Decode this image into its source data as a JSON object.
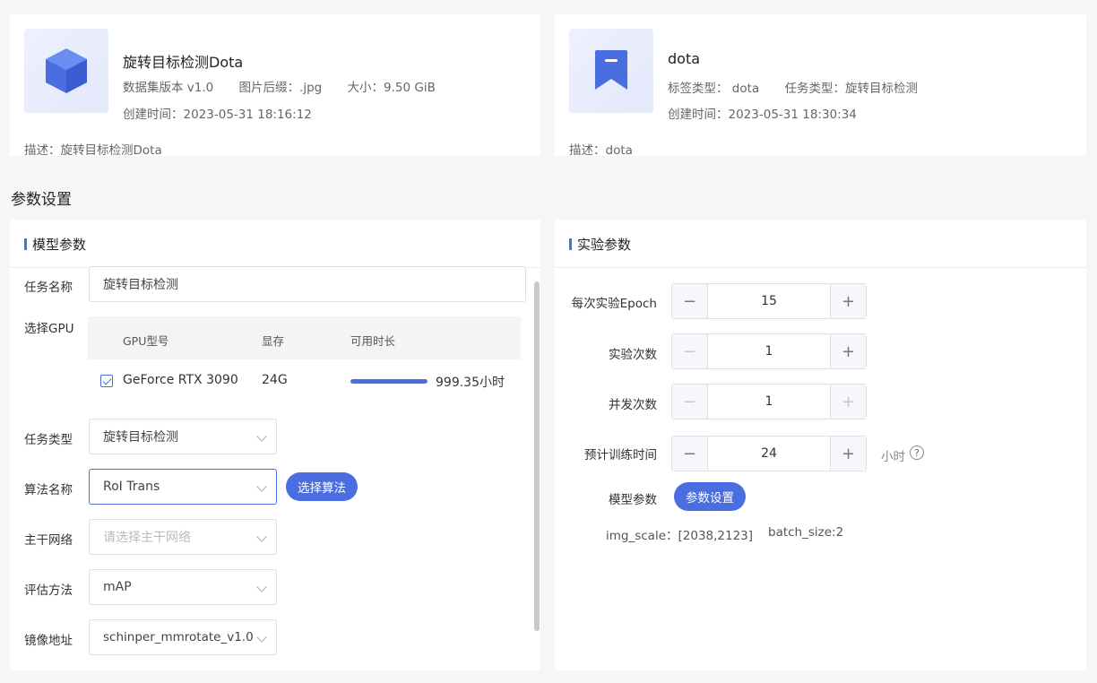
{
  "dataset_card": {
    "title": "旋转目标检测Dota",
    "version": "数据集版本 v1.0",
    "suffix": "图片后缀：.jpg",
    "size": "大小：9.50 GiB",
    "created": "创建时间：2023-05-31 18:16:12",
    "desc": "描述：旋转目标检测Dota",
    "icon": "cube-icon"
  },
  "label_card": {
    "title": "dota",
    "label_type": "标签类型：  dota",
    "task_type": "任务类型：旋转目标检测",
    "created": "创建时间：2023-05-31 18:30:34",
    "desc": "描述：dota",
    "icon": "bookmark-icon"
  },
  "section_title": "参数设置",
  "model_panel": {
    "title": "模型参数",
    "task_name_label": "任务名称",
    "task_name_value": "旋转目标检测",
    "gpu_label": "选择GPU",
    "gpu_table": {
      "headers": [
        "GPU型号",
        "显存",
        "可用时长"
      ],
      "rows": [
        {
          "model": "GeForce RTX 3090",
          "memory": "24G",
          "available": "999.35小时",
          "checked": true,
          "progress": 1.0
        }
      ]
    },
    "task_type_label": "任务类型",
    "task_type_value": "旋转目标检测",
    "algo_label": "算法名称",
    "algo_value": "RoI Trans",
    "algo_button": "选择算法",
    "backbone_label": "主干网络",
    "backbone_placeholder": "请选择主干网络",
    "eval_label": "评估方法",
    "eval_value": "mAP",
    "image_label": "镜像地址",
    "image_value": "schinper_mmrotate_v1.0"
  },
  "exp_panel": {
    "title": "实验参数",
    "epoch_label": "每次实验Epoch",
    "epoch_value": "15",
    "runs_label": "实验次数",
    "runs_value": "1",
    "concurrency_label": "并发次数",
    "concurrency_value": "1",
    "time_label": "预计训练时间",
    "time_value": "24",
    "time_unit": "小时",
    "help_glyph": "?",
    "model_param_label": "模型参数",
    "model_param_button": "参数设置",
    "img_scale": "img_scale：[2038,2123]",
    "batch_size": "batch_size:2"
  },
  "colors": {
    "accent": "#4a6ee0",
    "background": "#f5f6f8"
  }
}
